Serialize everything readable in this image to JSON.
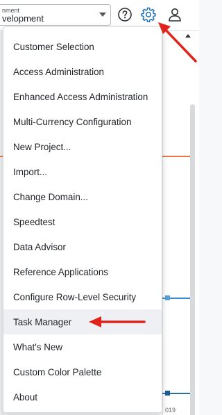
{
  "header": {
    "environment": {
      "label_partial": "nment",
      "value_partial": "velopment"
    },
    "icons": [
      "help-icon",
      "gear-icon",
      "user-icon"
    ],
    "accent_color": "#1b6fb8"
  },
  "menu": {
    "items": [
      {
        "label": "Customer Selection"
      },
      {
        "label": "Access Administration"
      },
      {
        "label": "Enhanced Access Administration"
      },
      {
        "label": "Multi-Currency Configuration"
      },
      {
        "label": "New Project..."
      },
      {
        "label": "Import..."
      },
      {
        "label": "Change Domain..."
      },
      {
        "label": "Speedtest"
      },
      {
        "label": "Data Advisor"
      },
      {
        "label": "Reference Applications"
      },
      {
        "label": "Configure Row-Level Security"
      },
      {
        "label": "Task Manager",
        "highlighted": true
      },
      {
        "label": "What's New"
      },
      {
        "label": "Custom Color Palette"
      },
      {
        "label": "About"
      }
    ]
  },
  "background": {
    "axis_text": "019"
  },
  "annotations": {
    "arrow_color": "#e0241b"
  }
}
